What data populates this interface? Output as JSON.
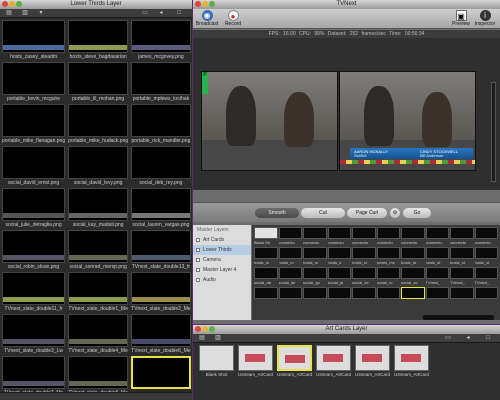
{
  "lower_thirds": {
    "title": "Lower Thirds Layer",
    "thumbs": [
      {
        "caption": "hosts_casey_steadm",
        "bar": "#4a6b9e"
      },
      {
        "caption": "hosts_steve_bagdasarian",
        "bar": "#8b9b50"
      },
      {
        "caption": "james_mcgovey.png",
        "bar": "#5a5a7e"
      },
      {
        "caption": "portable_kevin_mcguire",
        "bar": ""
      },
      {
        "caption": "portable_lil_mohan.png",
        "bar": ""
      },
      {
        "caption": "portable_mplews_krcihak",
        "bar": ""
      },
      {
        "caption": "portable_mike_flanagan.png",
        "bar": ""
      },
      {
        "caption": "portable_mike_hudack.png",
        "bar": ""
      },
      {
        "caption": "portable_rick_mandler.png",
        "bar": ""
      },
      {
        "caption": "social_david_ernst.png",
        "bar": ""
      },
      {
        "caption": "social_david_levy.png",
        "bar": ""
      },
      {
        "caption": "social_deb_rey.png",
        "bar": ""
      },
      {
        "caption": "social_julie_detraglia.png",
        "bar": "#555"
      },
      {
        "caption": "social_kay_madati.png",
        "bar": "#666"
      },
      {
        "caption": "social_lauren_vargas.png",
        "bar": "#777"
      },
      {
        "caption": "social_robin_sloan.png",
        "bar": "#556"
      },
      {
        "caption": "social_sonrad_mersp.png",
        "bar": "#665"
      },
      {
        "caption": "TVnext_slate_double13_fr",
        "bar": "#4e5a6e"
      },
      {
        "caption": "TVnext_slate_double11_fr",
        "bar": "#8b9b50"
      },
      {
        "caption": "TVnext_slate_double1_Me",
        "bar": "#8b9b50"
      },
      {
        "caption": "TVnext_slate_double2_Me",
        "bar": "#9c8e4a"
      },
      {
        "caption": "TVnext_slate_double3_Lw",
        "bar": "#556"
      },
      {
        "caption": "TVnext_slate_double4_Me",
        "bar": "#665"
      },
      {
        "caption": "TVnext_slate_double6_Me",
        "bar": "#4a4a6a"
      },
      {
        "caption": "TVnext_slate_double7_Me",
        "bar": "#556"
      },
      {
        "caption": "TVnext_slate_double8_Me",
        "bar": "#665"
      },
      {
        "caption": "",
        "bar": "",
        "selected": true
      }
    ]
  },
  "tvnext": {
    "title": "TVNext",
    "toolbar": {
      "broadcast": "Broadcast",
      "record": "Record",
      "preview": "Preview",
      "inspector": "Inspector"
    },
    "stats": "FPS: 16.00   CPU: 99%   Dataset: 252 frames/sec   Time: 00:56:34",
    "preview_tag": "P",
    "program_lower_name": "AARON MCNALLY",
    "program_lower_sub": "SwiftUI",
    "program_lower_name2": "CINDY STOCKWELL",
    "program_lower_sub2": "Bill Anderson",
    "transitions": {
      "smooth": "Smooth",
      "cut": "Cut",
      "page_curl": "Page Curl",
      "go": "Go"
    },
    "sources_header": "Master Layers",
    "sources": [
      {
        "label": "Art Cards",
        "selected": false
      },
      {
        "label": "Lower Thirds",
        "selected": true
      },
      {
        "label": "Camera",
        "selected": false
      },
      {
        "label": "Master Layer 4",
        "selected": false
      },
      {
        "label": "Audio",
        "selected": false
      }
    ],
    "source_thumbs": [
      {
        "caption": "Blank Sh",
        "white": true
      },
      {
        "caption": "connectu"
      },
      {
        "caption": "connectu"
      },
      {
        "caption": "connectu"
      },
      {
        "caption": "connectu"
      },
      {
        "caption": "connectu"
      },
      {
        "caption": "connectu"
      },
      {
        "caption": "connectu"
      },
      {
        "caption": "connectu"
      },
      {
        "caption": "connectu"
      },
      {
        "caption": "hosts_m"
      },
      {
        "caption": "hosts_m"
      },
      {
        "caption": "hosts_m"
      },
      {
        "caption": "hosts_s"
      },
      {
        "caption": "hosts_st"
      },
      {
        "caption": "james_mc"
      },
      {
        "caption": "hosts_ra"
      },
      {
        "caption": "hosts_st"
      },
      {
        "caption": "hosts_st"
      },
      {
        "caption": "hosts_st"
      },
      {
        "caption": "social_da"
      },
      {
        "caption": "social_de"
      },
      {
        "caption": "social_gu"
      },
      {
        "caption": "social_ja"
      },
      {
        "caption": "social_ke"
      },
      {
        "caption": "social_ro"
      },
      {
        "caption": "social_sc"
      },
      {
        "caption": "TVnext_"
      },
      {
        "caption": "TVnext_"
      },
      {
        "caption": "TVnext_"
      },
      {
        "caption": ""
      },
      {
        "caption": ""
      },
      {
        "caption": ""
      },
      {
        "caption": ""
      },
      {
        "caption": ""
      },
      {
        "caption": ""
      },
      {
        "caption": "",
        "selected": true
      },
      {
        "caption": ""
      },
      {
        "caption": ""
      },
      {
        "caption": ""
      }
    ]
  },
  "art_cards": {
    "title": "Art Cards Layer",
    "cards": [
      {
        "caption": "Blank Shot",
        "selected": false
      },
      {
        "caption": "Ustream_ArtCard",
        "selected": false
      },
      {
        "caption": "Ustream_ArtCard",
        "selected": true
      },
      {
        "caption": "Ustream_ArtCard",
        "selected": false
      },
      {
        "caption": "Ustream_ArtCard",
        "selected": false
      },
      {
        "caption": "Ustream_ArtCard",
        "selected": false
      }
    ]
  }
}
